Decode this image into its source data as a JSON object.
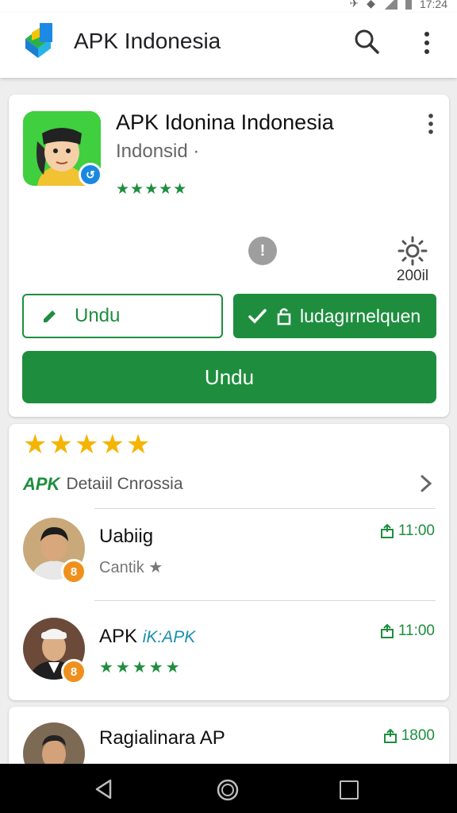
{
  "status_bar": {
    "time": "17:24"
  },
  "app_bar": {
    "title": "APK Indonesia"
  },
  "app": {
    "name": "APK Idonina Indonesia",
    "developer": "Indonsid ·",
    "rating_stars": "★★★★★",
    "icon_badge": "↺"
  },
  "stats": {
    "info_glyph": "!",
    "settings_value": "200il"
  },
  "buttons": {
    "outline_label": "Undu",
    "filled_label": "ludagırnelquen",
    "main_label": "Undu"
  },
  "reviews_card": {
    "rating_stars": "★★★★★",
    "details_logo": "APK",
    "details_label": "Detaiil Cnrossia",
    "reviews": [
      {
        "name": "Uabiig",
        "sub": "Cantik ★",
        "time": "11:00",
        "badge": "8"
      },
      {
        "name": "APK",
        "name_tag": "iK:APK",
        "stars": "★★★★★",
        "time": "11:00",
        "badge": "8"
      }
    ]
  },
  "third_card": {
    "name": "Ragialinara AP",
    "time": "1800"
  },
  "colors": {
    "accent": "#1e8e3e",
    "star": "#f5b400",
    "badge": "#f0901c",
    "app_icon_bg": "#3fcf3f"
  }
}
